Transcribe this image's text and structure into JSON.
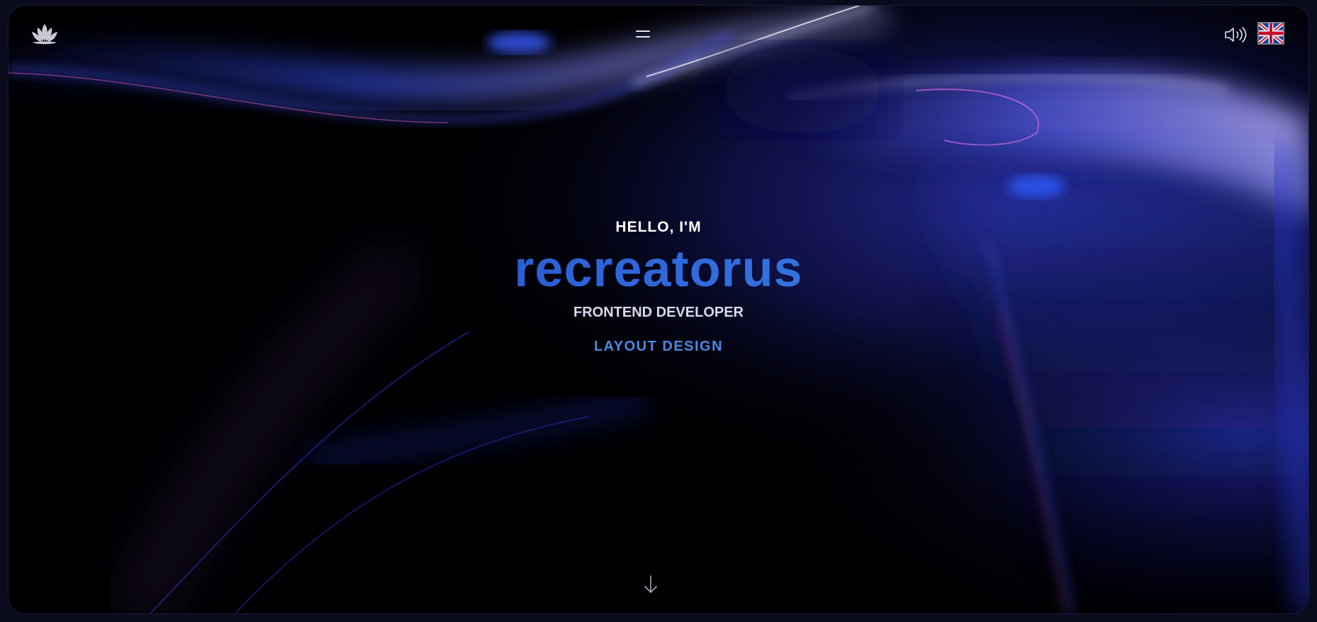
{
  "header": {
    "logo_icon": "lotus-icon",
    "menu_icon": "hamburger-menu-icon",
    "sound_icon": "speaker-icon",
    "language_icon": "uk-flag-icon"
  },
  "hero": {
    "greeting": "HELLO, I'M",
    "name": "recreatorus",
    "role": "FRONTEND DEVELOPER",
    "specialty": "LAYOUT DESIGN"
  },
  "scroll": {
    "icon": "arrow-down-icon"
  },
  "colors": {
    "background": "#000003",
    "name_gradient_start": "#1f3fb4",
    "name_gradient_end": "#3f97f0",
    "specialty": "#4a8ae6",
    "text": "#ffffff"
  }
}
